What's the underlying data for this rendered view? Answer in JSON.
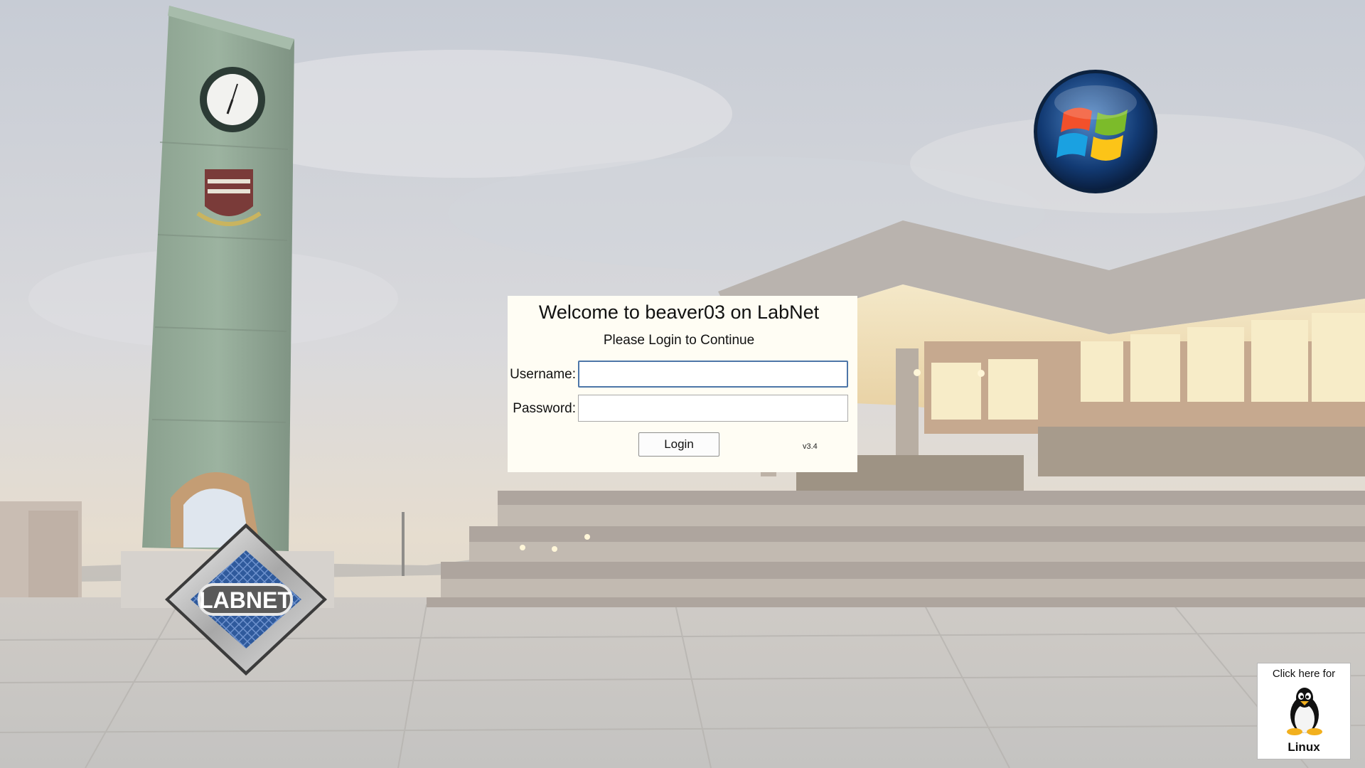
{
  "login": {
    "title": "Welcome to beaver03 on LabNet",
    "subtitle": "Please Login to Continue",
    "username_label": "Username:",
    "username_value": "",
    "password_label": "Password:",
    "password_value": "",
    "login_button": "Login",
    "version": "v3.4"
  },
  "linux_switch": {
    "top_text": "Click here for",
    "bottom_text": "Linux",
    "icon": "tux-penguin-icon"
  },
  "logos": {
    "labnet_text": "LABNET",
    "windows_icon": "windows-logo-icon"
  },
  "colors": {
    "panel_background": "#fffdf4",
    "input_focus_border": "#4d76a8"
  }
}
